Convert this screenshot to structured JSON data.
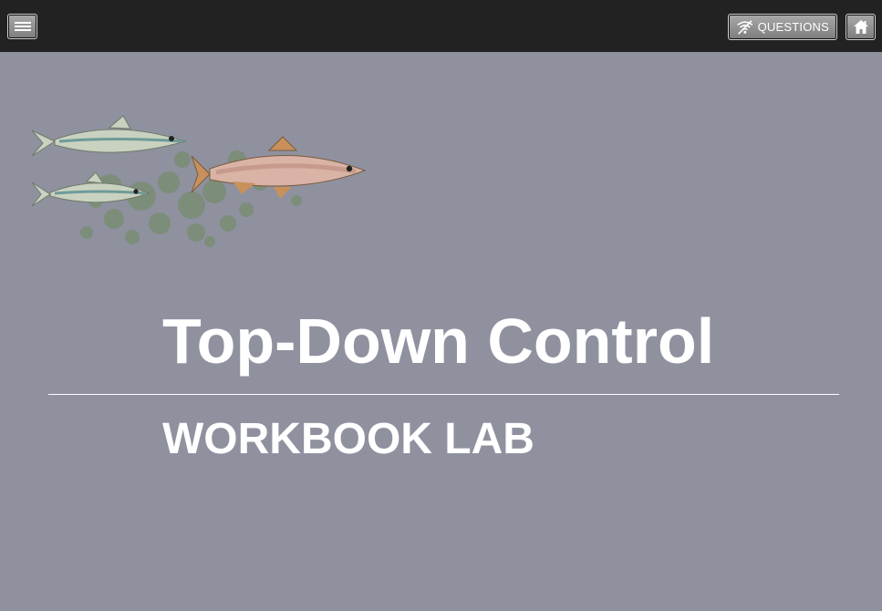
{
  "topbar": {
    "menu": {
      "icon": "hamburger-menu-icon"
    },
    "questions": {
      "label": "QUESTIONS",
      "icon": "no-signal-icon"
    },
    "home": {
      "icon": "home-icon"
    }
  },
  "hero": {
    "title": "Top-Down Control",
    "subtitle": "WORKBOOK LAB"
  },
  "colors": {
    "background": "#8f919f",
    "topbar": "#222222",
    "text": "#ffffff"
  }
}
